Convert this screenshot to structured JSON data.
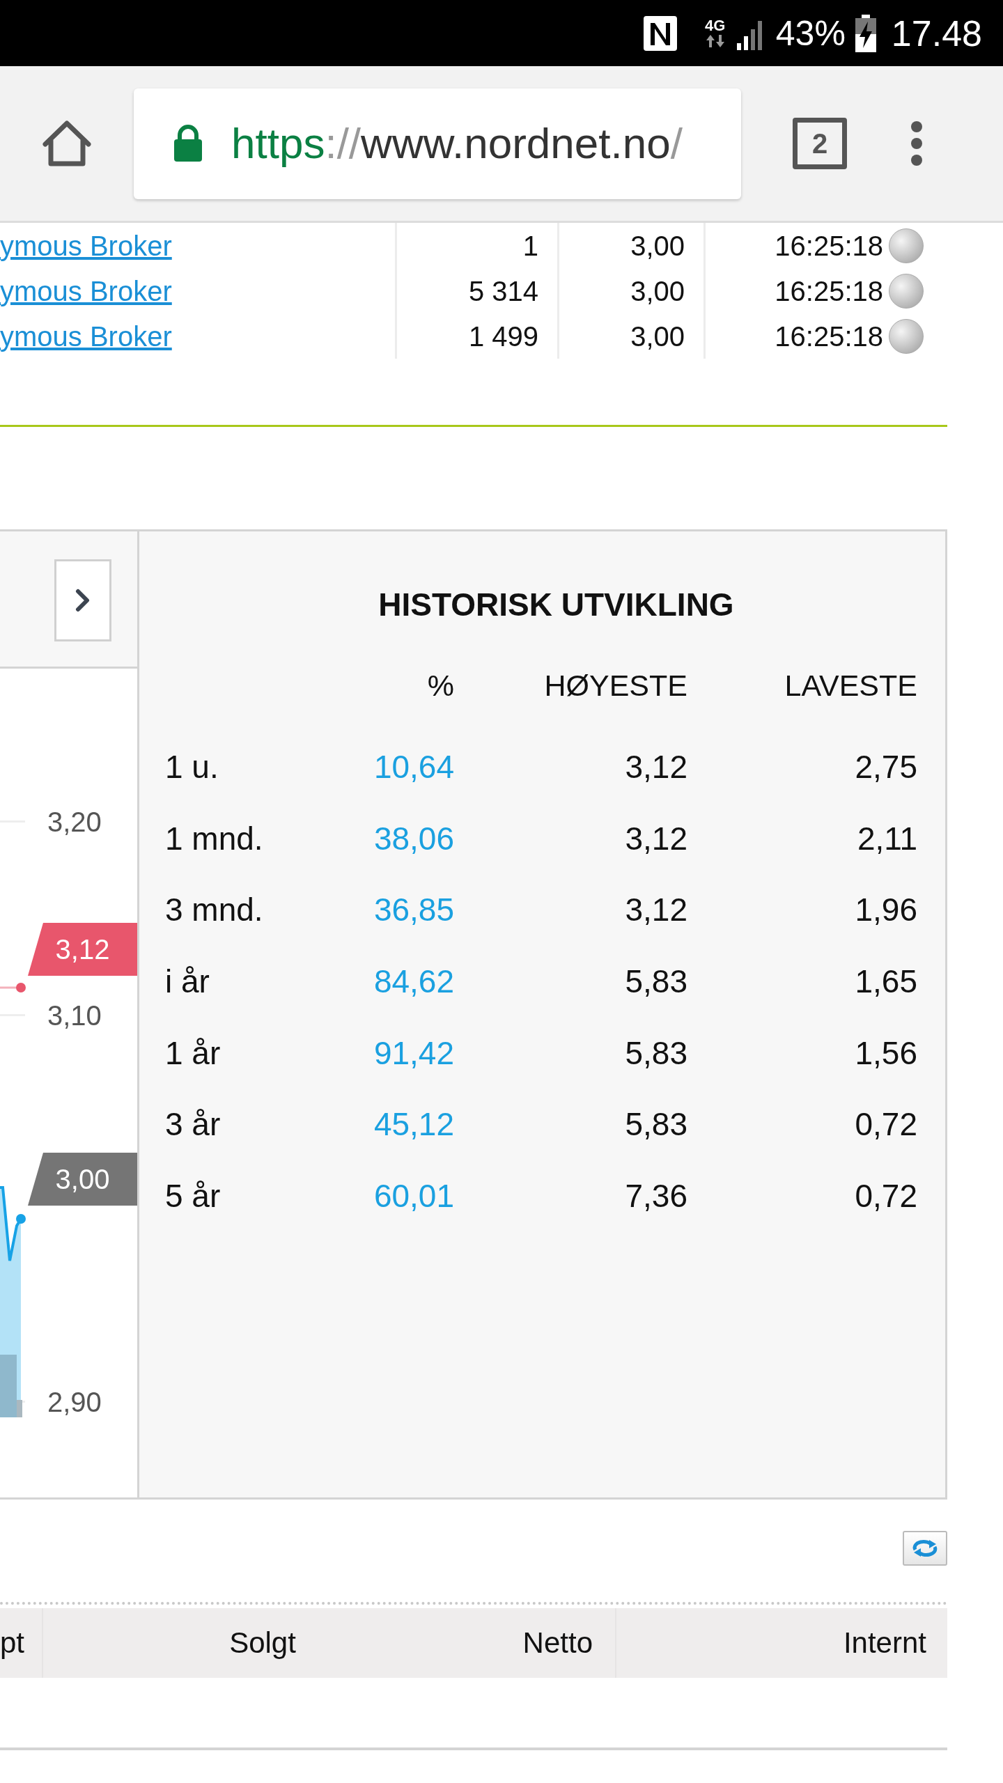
{
  "status_bar": {
    "network": "4G",
    "battery": "43%",
    "time": "17.48"
  },
  "browser": {
    "url_scheme": "https",
    "url_separator": "://",
    "url_host": "www.nordnet.no",
    "url_path": "/",
    "tab_count": "2"
  },
  "trades": [
    {
      "broker": "ymous Broker",
      "quantity": "1",
      "price": "3,00",
      "time": "16:25:18"
    },
    {
      "broker": "ymous Broker",
      "quantity": "5 314",
      "price": "3,00",
      "time": "16:25:18"
    },
    {
      "broker": "ymous Broker",
      "quantity": "1 499",
      "price": "3,00",
      "time": "16:25:18"
    }
  ],
  "chart": {
    "y_labels": [
      "3,20",
      "3,10",
      "2,90"
    ],
    "tags": [
      {
        "text": "3,12",
        "color": "#e8566c"
      },
      {
        "text": "3,00",
        "color": "#757575"
      }
    ]
  },
  "history": {
    "title": "HISTORISK UTVIKLING",
    "columns": [
      "%",
      "HØYESTE",
      "LAVESTE"
    ],
    "rows": [
      {
        "period": "1 u.",
        "change": "10,64",
        "high": "3,12",
        "low": "2,75"
      },
      {
        "period": "1 mnd.",
        "change": "38,06",
        "high": "3,12",
        "low": "2,11"
      },
      {
        "period": "3 mnd.",
        "change": "36,85",
        "high": "3,12",
        "low": "1,96"
      },
      {
        "period": "i år",
        "change": "84,62",
        "high": "5,83",
        "low": "1,65"
      },
      {
        "period": "1 år",
        "change": "91,42",
        "high": "5,83",
        "low": "1,56"
      },
      {
        "period": "3 år",
        "change": "45,12",
        "high": "5,83",
        "low": "0,72"
      },
      {
        "period": "5 år",
        "change": "60,01",
        "high": "7,36",
        "low": "0,72"
      }
    ]
  },
  "bottom_table": {
    "columns": [
      "pt",
      "Solgt",
      "Netto",
      "Internt"
    ]
  }
}
